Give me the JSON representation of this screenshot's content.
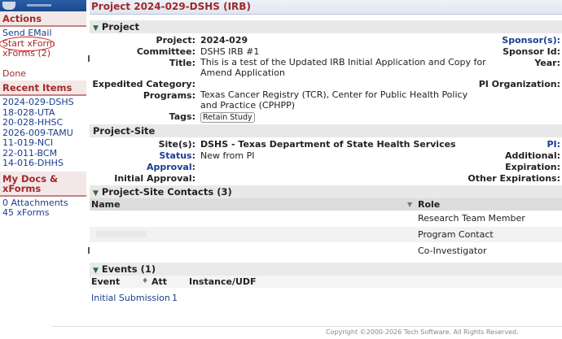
{
  "sidebar": {
    "actions_header": "Actions",
    "actions": [
      "Send EMail",
      "Start xForm",
      "xForms (2)"
    ],
    "done": "Done",
    "recent_header": "Recent Items",
    "recent": [
      "2024-029-DSHS",
      "18-028-UTA",
      "20-028-HHSC",
      "2026-009-TAMU",
      "11-019-NCI",
      "22-011-BCM",
      "14-016-DHHS"
    ],
    "docs_header": "My Docs & xForms",
    "docs": [
      "0 Attachments",
      "45 xForms"
    ]
  },
  "page": {
    "title": "Project 2024-029-DSHS (IRB)"
  },
  "project": {
    "header": "Project",
    "project_label": "Project:",
    "project_value": "2024-029",
    "committee_label": "Committee:",
    "committee_value": "DSHS IRB #1",
    "title_label": "Title:",
    "title_line1": "This is a test of the Updated IRB Initial Application and Copy for",
    "title_line2": "Amend Application",
    "expedited_label": "Expedited Category:",
    "programs_label": "Programs:",
    "programs_line1": "Texas Cancer Registry (TCR), Center for Public Health Policy",
    "programs_line2": "and Practice (CPHPP)",
    "tags_label": "Tags:",
    "tag": "Retain Study",
    "sponsors_label": "Sponsor(s):",
    "sponsor_id_label": "Sponsor Id:",
    "year_label": "Year:",
    "pi_org_label": "PI Organization:"
  },
  "site": {
    "header": "Project-Site",
    "sites_label": "Site(s):",
    "sites_value": "DSHS - Texas Department of State Health Services",
    "status_label": "Status:",
    "status_value": "New from PI",
    "approval_label": "Approval:",
    "initial_approval_label": "Initial Approval:",
    "pi_label": "PI:",
    "additional_label": "Additional:",
    "expiration_label": "Expiration:",
    "other_exp_label": "Other Expirations:"
  },
  "contacts": {
    "header": "Project-Site Contacts (3)",
    "col_name": "Name",
    "col_role": "Role",
    "rows": [
      {
        "role": "Research Team Member"
      },
      {
        "role": "Program Contact"
      },
      {
        "role": "Co-Investigator"
      }
    ]
  },
  "events": {
    "header": "Events (1)",
    "col_event": "Event",
    "col_att": "Att",
    "col_instance": "Instance/UDF",
    "rows": [
      {
        "event": "Initial Submission",
        "att": "1"
      }
    ]
  },
  "footer": {
    "copyright": "Copyright ©2000-2026 Tech Software. All Rights Reserved."
  },
  "icons": {
    "section_toggle": "caret-down-icon",
    "sort": "sort-icon",
    "dropdown": "chevron-down-icon"
  }
}
